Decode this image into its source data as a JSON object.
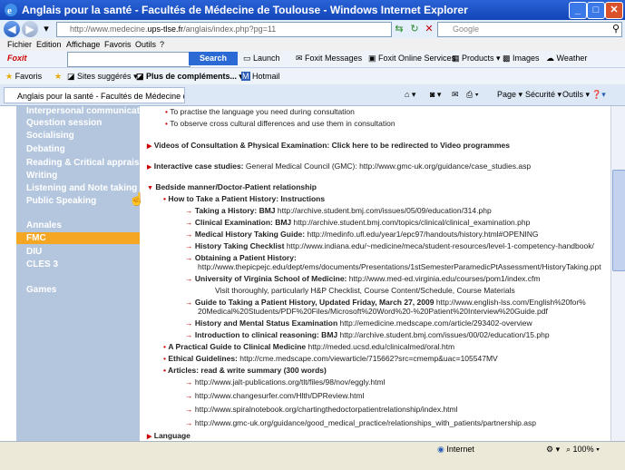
{
  "window": {
    "title": "Anglais pour la santé - Facultés de Médecine de Toulouse - Windows Internet Explorer",
    "min": "_",
    "max": "□",
    "close": "✕"
  },
  "address": {
    "url_prefix": "http://www.medecine.",
    "url_domain": "ups-tlse.fr",
    "url_suffix": "/anglais/index.php?pg=11",
    "search_placeholder": "Google"
  },
  "menu": [
    "Fichier",
    "Edition",
    "Affichage",
    "Favoris",
    "Outils",
    "?"
  ],
  "foxit": {
    "logo": "Foxit",
    "search_label": "Search",
    "items": [
      "Launch",
      "Foxit Messages",
      "Foxit Online Services",
      "Products",
      "Images",
      "Weather"
    ]
  },
  "favorites": {
    "label": "Favoris",
    "items": [
      "Sites suggérés",
      "Plus de compléments...",
      "Hotmail"
    ]
  },
  "tab": {
    "title": "Anglais pour la santé - Facultés de Médecine de Toulo...",
    "tools": [
      "Page",
      "Sécurité",
      "Outils"
    ]
  },
  "sidebar": {
    "items": [
      "Interpersonal communication",
      "Question session",
      "Socialising",
      "Debating",
      "Reading & Critical appraisal",
      "Writing",
      "Listening and Note taking",
      "Public Speaking"
    ],
    "sections": [
      "Annales",
      "FMC",
      "DIU",
      "CLES 3",
      "Games"
    ]
  },
  "main": {
    "top_bullets": [
      "To practise the language you need during consultation",
      "To observe cross cultural differences and use them in consultation"
    ],
    "videos": "Videos of Consultation & Physical Examination: Click here to be redirected to Video programmes",
    "interactive_label": "Interactive case studies:",
    "interactive_text": "General Medical Council (GMC): http://www.gmc-uk.org/guidance/case_studies.asp",
    "bedside": "Bedside manner/Doctor-Patient relationship",
    "howto": "How to Take a Patient History: Instructions",
    "links": [
      {
        "label": "Taking a History: BMJ",
        "url": "http://archive.student.bmj.com/issues/05/09/education/314.php"
      },
      {
        "label": "Clinical Examination: BMJ",
        "url": "http://archive.student.bmj.com/topics/clinical/clinical_examination.php"
      },
      {
        "label": "Medical History Taking Guide:",
        "url": "http://medinfo.ufl.edu/year1/epc97/handouts/history.html#OPENING"
      },
      {
        "label": "History Taking Checklist",
        "url": "http://www.indiana.edu/~medicine/meca/student-resources/level-1-competency-handbook/"
      },
      {
        "label": "Obtaining a Patient History:",
        "url": ""
      },
      {
        "label": "University of Virginia School of Medicine:",
        "url": "http://www.med-ed.virginia.edu/courses/pom1/index.cfm"
      },
      {
        "label": "Guide to Taking a Patient History, Updated Friday, March 27, 2009",
        "url": "http://www.english-lss.com/English%20for%"
      },
      {
        "label": "History and Mental Status Examination",
        "url": "http://emedicine.medscape.com/article/293402-overview"
      },
      {
        "label": "Introduction to clinical reasoning: BMJ",
        "url": "http://archive.student.bmj.com/issues/00/02/education/15.php"
      }
    ],
    "obtaining_url": "http://www.thepicpejc.edu/dept/ems/documents/Presentations/1stSemesterParamedicPtAssessment/HistoryTaking.ppt",
    "virginia_note": "Visit thoroughly, particularly H&P Checklist, Course Content/Schedule, Course Materials",
    "guide_cont": "20Medical%20Students/PDF%20Files/Microsoft%20Word%20-%20Patient%20Interview%20Guide.pdf",
    "practical_label": "A Practical Guide to Clinical Medicine",
    "practical_url": "http://meded.ucsd.edu/clinicalmed/oral.htm",
    "ethical_label": "Ethical Guidelines:",
    "ethical_url": "http://cme.medscape.com/viewarticle/715662?src=cmemp&uac=105547MV",
    "articles_label": "Articles: read & write summary (300 words)",
    "articles": [
      "http://www.jalt-publications.org/tlt/files/98/nov/eggly.html",
      "http://www.changesurfer.com/Hlth/DPReview.html",
      "http://www.spiralnotebook.org/chartingthedoctorpatientrelationship/index.html",
      "http://www.gmc-uk.org/guidance/good_medical_practice/relationships_with_patients/partnership.asp"
    ],
    "language": "Language"
  },
  "status": {
    "zone": "Internet",
    "zoom": "100%"
  }
}
